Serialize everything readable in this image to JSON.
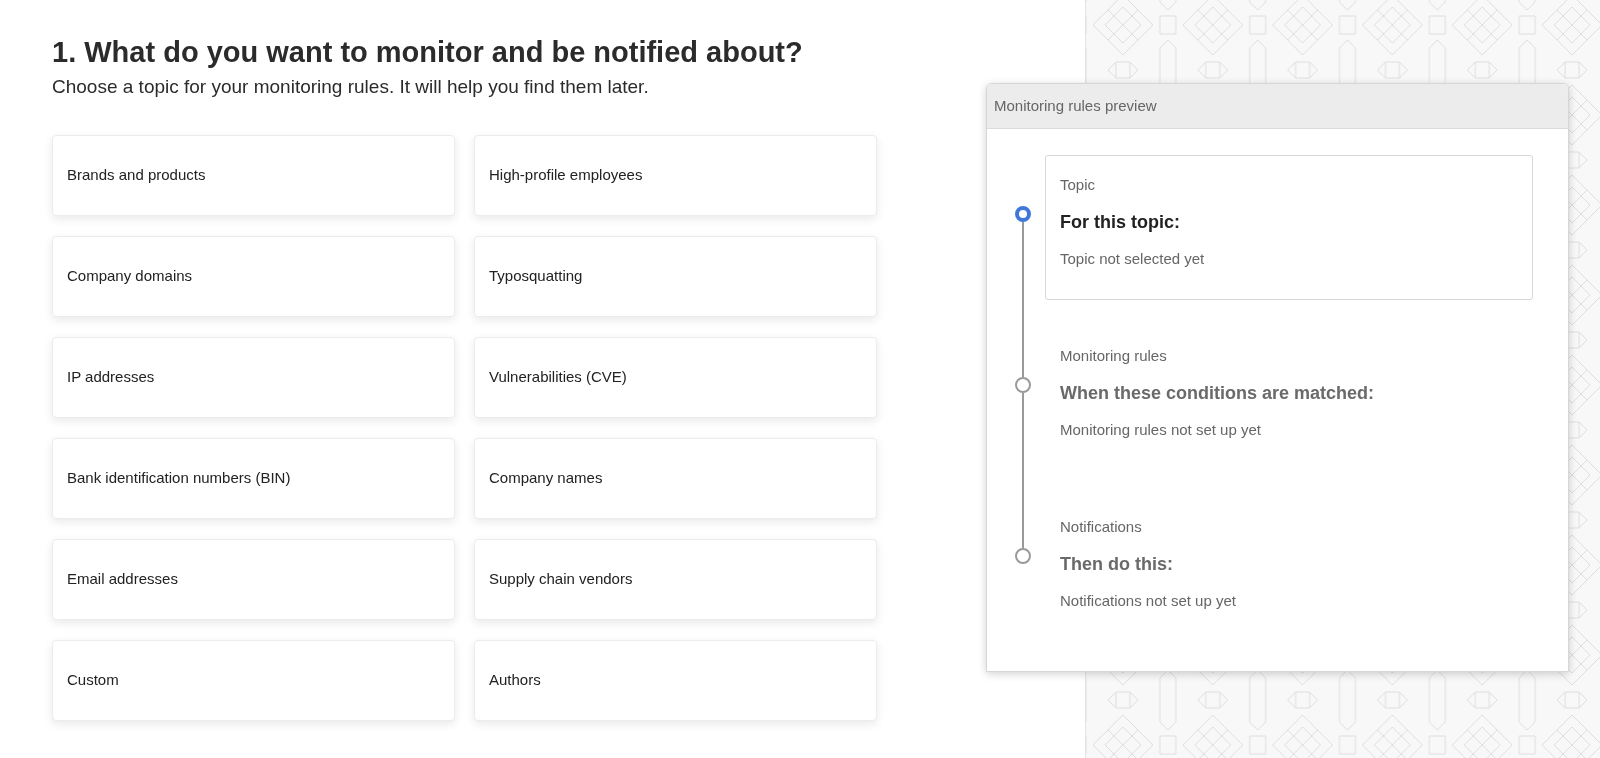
{
  "heading": {
    "title": "1. What do you want to monitor and be notified about?",
    "subtitle": "Choose a topic for your monitoring rules. It will help you find them later."
  },
  "topics": [
    {
      "label": "Brands and products",
      "selected": false
    },
    {
      "label": "High-profile employees",
      "selected": false
    },
    {
      "label": "Company domains",
      "selected": false
    },
    {
      "label": "Typosquatting",
      "selected": false
    },
    {
      "label": "IP addresses",
      "selected": false
    },
    {
      "label": "Vulnerabilities (CVE)",
      "selected": false
    },
    {
      "label": "Bank identification numbers (BIN)",
      "selected": false
    },
    {
      "label": "Company names",
      "selected": false
    },
    {
      "label": "Email addresses",
      "selected": false
    },
    {
      "label": "Supply chain vendors",
      "selected": false
    },
    {
      "label": "Custom",
      "selected": false
    },
    {
      "label": "Authors",
      "selected": false
    }
  ],
  "preview": {
    "title": "Monitoring rules preview",
    "steps": [
      {
        "label": "Topic",
        "heading": "For this topic:",
        "status": "Topic not selected yet",
        "active": true
      },
      {
        "label": "Monitoring rules",
        "heading": "When these conditions are matched:",
        "status": "Monitoring rules not set up yet",
        "active": false
      },
      {
        "label": "Notifications",
        "heading": "Then do this:",
        "status": "Notifications not set up yet",
        "active": false
      }
    ]
  }
}
